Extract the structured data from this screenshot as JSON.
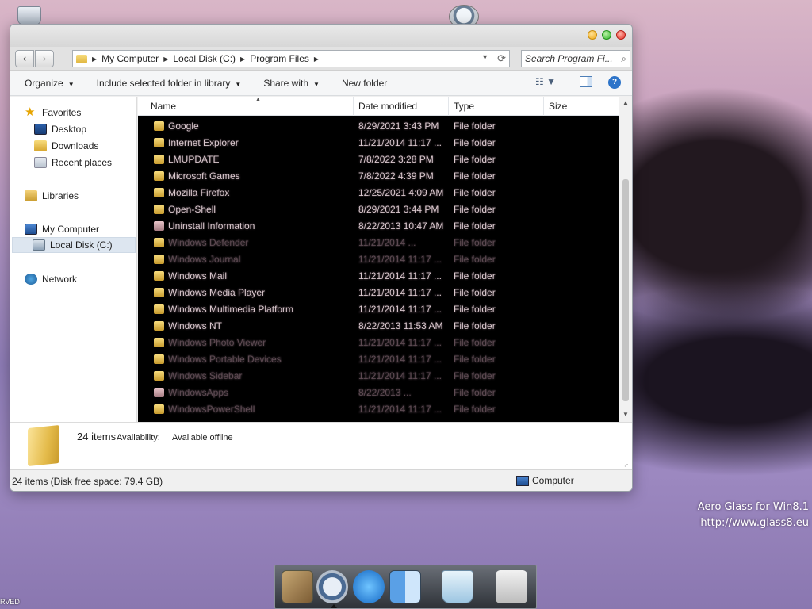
{
  "desktop": {
    "watermark_line1": "Aero Glass for Win8.1",
    "watermark_line2": "http://www.glass8.eu",
    "corner_text": "RVED"
  },
  "window": {
    "nav": {
      "back": "‹",
      "forward": "›"
    },
    "address": {
      "crumbs": [
        "My Computer",
        "Local Disk (C:)",
        "Program Files"
      ],
      "separator": "▶",
      "dropdown": "▼",
      "refresh": "⟳"
    },
    "search": {
      "placeholder": "Search Program Fi...",
      "icon": "⌕"
    },
    "toolbar": {
      "organize": "Organize",
      "include": "Include selected folder in library",
      "share": "Share with",
      "new_folder": "New folder",
      "caret": "▼",
      "help": "?",
      "views": "☷ ▼"
    },
    "navpane": {
      "favorites": "Favorites",
      "desktop": "Desktop",
      "downloads": "Downloads",
      "recent": "Recent places",
      "libraries": "Libraries",
      "computer": "My Computer",
      "local_disk": "Local Disk (C:)",
      "network": "Network",
      "star": "★"
    },
    "columns": {
      "name": "Name",
      "date": "Date modified",
      "type": "Type",
      "size": "Size",
      "sort_arrow": "▲"
    },
    "rows": [
      {
        "name": "Google",
        "date": "8/29/2021 3:43 PM",
        "type": "File folder"
      },
      {
        "name": "Internet Explorer",
        "date": "11/21/2014 11:17 ...",
        "type": "File folder"
      },
      {
        "name": "LMUPDATE",
        "date": "7/8/2022 3:28 PM",
        "type": "File folder"
      },
      {
        "name": "Microsoft Games",
        "date": "7/8/2022 4:39 PM",
        "type": "File folder"
      },
      {
        "name": "Mozilla Firefox",
        "date": "12/25/2021 4:09 AM",
        "type": "File folder"
      },
      {
        "name": "Open-Shell",
        "date": "8/29/2021 3:44 PM",
        "type": "File folder"
      },
      {
        "name": "Uninstall Information",
        "date": "8/22/2013 10:47 AM",
        "type": "File folder"
      },
      {
        "name": "Windows Defender",
        "date": "11/21/2014 ...",
        "type": "File folder"
      },
      {
        "name": "Windows Journal",
        "date": "11/21/2014 11:17 ...",
        "type": "File folder"
      },
      {
        "name": "Windows Mail",
        "date": "11/21/2014 11:17 ...",
        "type": "File folder"
      },
      {
        "name": "Windows Media Player",
        "date": "11/21/2014 11:17 ...",
        "type": "File folder"
      },
      {
        "name": "Windows Multimedia Platform",
        "date": "11/21/2014 11:17 ...",
        "type": "File folder"
      },
      {
        "name": "Windows NT",
        "date": "8/22/2013 11:53 AM",
        "type": "File folder"
      },
      {
        "name": "Windows Photo Viewer",
        "date": "11/21/2014 11:17 ...",
        "type": "File folder"
      },
      {
        "name": "Windows Portable Devices",
        "date": "11/21/2014 11:17 ...",
        "type": "File folder"
      },
      {
        "name": "Windows Sidebar",
        "date": "11/21/2014 11:17 ...",
        "type": "File folder"
      },
      {
        "name": "WindowsApps",
        "date": "8/22/2013 ...",
        "type": "File folder"
      },
      {
        "name": "WindowsPowerShell",
        "date": "11/21/2014 11:17 ...",
        "type": "File folder"
      }
    ],
    "scroll": {
      "up": "▲",
      "down": "▼"
    },
    "details": {
      "count": "24 items",
      "availability_label": "Availability:",
      "availability_value": "Available offline",
      "grip": "⋰"
    },
    "status": {
      "left": "24 items (Disk free space: 79.4 GB)",
      "right": "Computer"
    }
  },
  "dock": {
    "apple": ""
  }
}
